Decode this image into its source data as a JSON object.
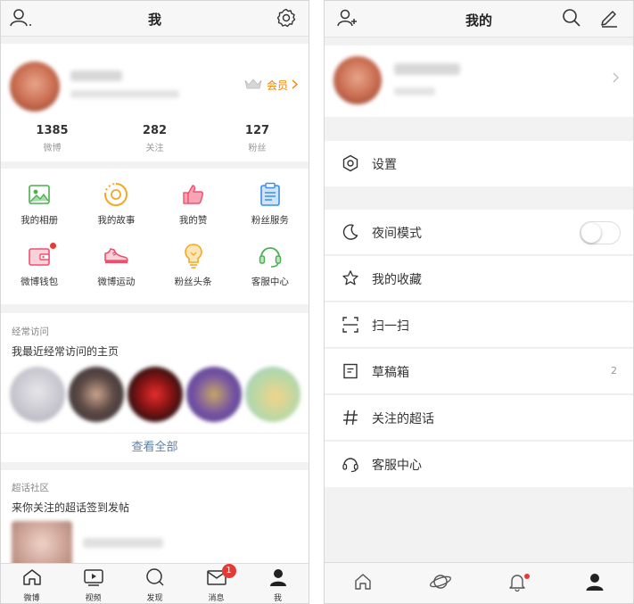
{
  "screen1": {
    "header": {
      "title": "我"
    },
    "profile": {
      "vip_label": "会员"
    },
    "stats": [
      {
        "num": "1385",
        "label": "微博"
      },
      {
        "num": "282",
        "label": "关注"
      },
      {
        "num": "127",
        "label": "粉丝"
      }
    ],
    "grid": [
      {
        "label": "我的相册",
        "icon": "photo-album-icon",
        "color": "#4caf50"
      },
      {
        "label": "我的故事",
        "icon": "story-icon",
        "color": "#f5a623"
      },
      {
        "label": "我的赞",
        "icon": "thumbs-up-icon",
        "color": "#f0506e"
      },
      {
        "label": "粉丝服务",
        "icon": "clipboard-icon",
        "color": "#3a8ee6"
      },
      {
        "label": "微博钱包",
        "icon": "wallet-icon",
        "color": "#f0506e"
      },
      {
        "label": "微博运动",
        "icon": "sneaker-icon",
        "color": "#f0506e"
      },
      {
        "label": "粉丝头条",
        "icon": "lightbulb-icon",
        "color": "#f5a623"
      },
      {
        "label": "客服中心",
        "icon": "headset-icon",
        "color": "#4caf50"
      }
    ],
    "frequent": {
      "caption": "经常访问",
      "title": "我最近经常访问的主页",
      "view_all": "查看全部"
    },
    "topic": {
      "caption": "超话社区",
      "title": "来你关注的超话签到发帖"
    },
    "tabbar": [
      {
        "label": "微博",
        "icon": "home-icon"
      },
      {
        "label": "视频",
        "icon": "video-icon"
      },
      {
        "label": "发现",
        "icon": "discover-icon"
      },
      {
        "label": "消息",
        "icon": "message-icon",
        "badge": "1"
      },
      {
        "label": "我",
        "icon": "profile-icon"
      }
    ]
  },
  "screen2": {
    "header": {
      "title": "我的"
    },
    "rows": [
      {
        "label": "设置",
        "icon": "settings-hexagon-icon"
      },
      {
        "label": "夜间模式",
        "icon": "moon-icon",
        "toggle": false
      },
      {
        "label": "我的收藏",
        "icon": "star-icon"
      },
      {
        "label": "扫一扫",
        "icon": "scan-icon"
      },
      {
        "label": "草稿箱",
        "icon": "drafts-icon",
        "count": "2"
      },
      {
        "label": "关注的超话",
        "icon": "hashtag-icon"
      },
      {
        "label": "客服中心",
        "icon": "headset-icon"
      }
    ],
    "tabbar": [
      "home-icon",
      "planet-icon",
      "bell-icon",
      "profile-icon"
    ],
    "accent": "#e53935"
  }
}
